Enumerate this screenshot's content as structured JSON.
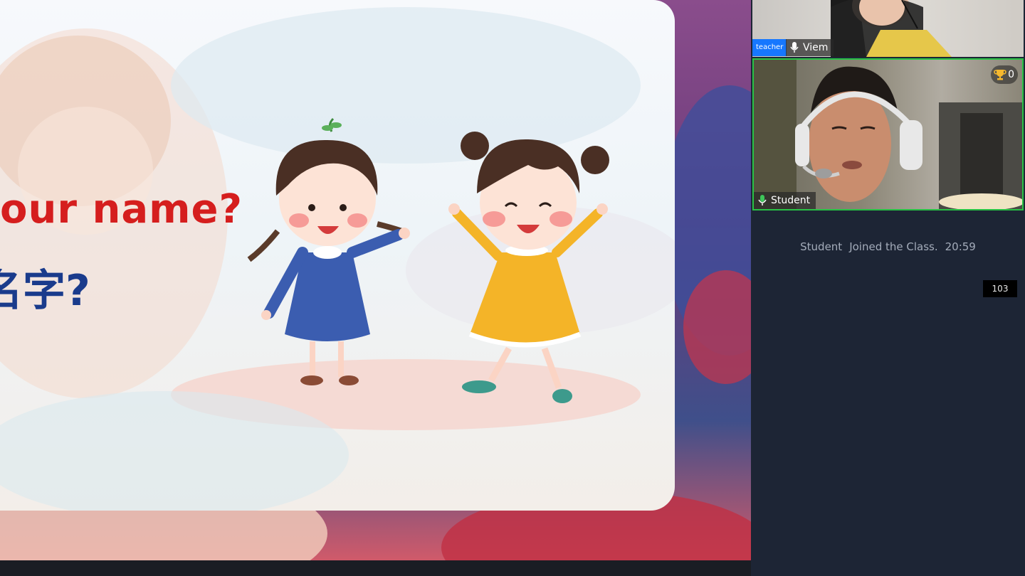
{
  "slide": {
    "question_en": "our name?",
    "question_cn": "名字?"
  },
  "teacher_tile": {
    "role_badge": "teacher",
    "name": "Viem"
  },
  "student_tile": {
    "name": "Student",
    "trophy_count": "0"
  },
  "chat": {
    "join_name": "Student",
    "join_text": "Joined the Class.",
    "join_time": "20:59"
  },
  "counter": "103",
  "colors": {
    "slide_english_text": "#d51e1e",
    "slide_chinese_text": "#1a3b8c",
    "active_speaker_border": "#28c245",
    "teacher_badge": "#1677ff",
    "sidebar_background": "#1d2535"
  },
  "icons": {
    "mic": "microphone-icon",
    "trophy": "trophy-icon"
  }
}
